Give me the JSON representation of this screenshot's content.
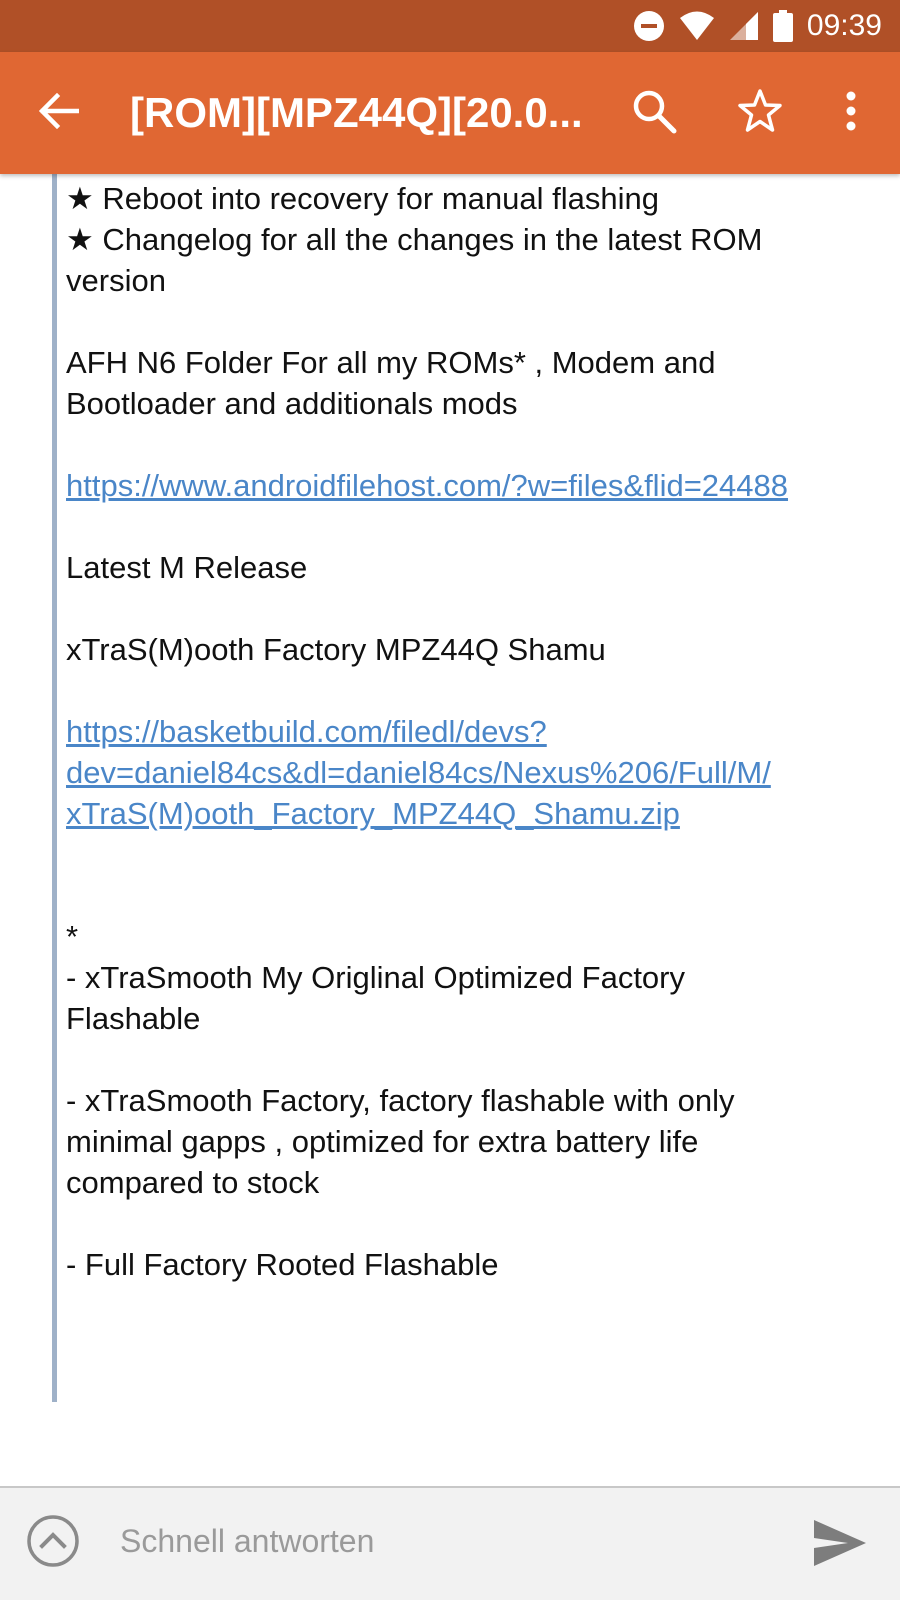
{
  "status_bar": {
    "time": "09:39",
    "icons": [
      "do-not-disturb-icon",
      "wifi-icon",
      "cell-signal-icon",
      "battery-icon"
    ]
  },
  "app_bar": {
    "title": "[ROM][MPZ44Q][20.0...",
    "icons": [
      "back-arrow-icon",
      "search-icon",
      "star-outline-icon",
      "more-vert-icon"
    ]
  },
  "post": {
    "lines": [
      {
        "text": "★ Reboot into recovery for manual flashing",
        "type": "text"
      },
      {
        "text": "★ Changelog for all the changes in the latest ROM",
        "type": "text"
      },
      {
        "text": "version",
        "type": "text"
      },
      {
        "text": "",
        "type": "gap"
      },
      {
        "text": "AFH N6 Folder For all my ROMs* , Modem and",
        "type": "text"
      },
      {
        "text": "Bootloader and additionals mods",
        "type": "text"
      },
      {
        "text": "",
        "type": "gap"
      },
      {
        "text": "https://www.androidfilehost.com/?w=files&flid=24488",
        "type": "link"
      },
      {
        "text": "",
        "type": "gap"
      },
      {
        "text": "Latest M Release",
        "type": "text"
      },
      {
        "text": "",
        "type": "gap"
      },
      {
        "text": "xTraS(M)ooth Factory MPZ44Q Shamu",
        "type": "text"
      },
      {
        "text": "",
        "type": "gap"
      },
      {
        "text": "https://basketbuild.com/filedl/devs?",
        "type": "link"
      },
      {
        "text": "dev=daniel84cs&dl=daniel84cs/Nexus%206/Full/M/",
        "type": "link"
      },
      {
        "text": "xTraS(M)ooth_Factory_MPZ44Q_Shamu.zip",
        "type": "link"
      },
      {
        "text": "",
        "type": "gap"
      },
      {
        "text": "",
        "type": "gap"
      },
      {
        "text": "*",
        "type": "text"
      },
      {
        "text": "- xTraSmooth My Origlinal Optimized Factory",
        "type": "text"
      },
      {
        "text": "Flashable",
        "type": "text"
      },
      {
        "text": "",
        "type": "gap"
      },
      {
        "text": "- xTraSmooth Factory, factory flashable with only",
        "type": "text"
      },
      {
        "text": "minimal gapps , optimized for extra battery life",
        "type": "text"
      },
      {
        "text": "compared to stock",
        "type": "text"
      },
      {
        "text": "",
        "type": "gap"
      },
      {
        "text": "- Full Factory Rooted Flashable",
        "type": "text"
      }
    ]
  },
  "reply_bar": {
    "placeholder": "Schnell antworten",
    "value": "",
    "icons": [
      "expand-up-icon",
      "send-icon"
    ]
  },
  "colors": {
    "status_bar": "#b05027",
    "app_bar": "#e06733",
    "link": "#4a86c8",
    "quote_bar": "#9fb1c8"
  }
}
